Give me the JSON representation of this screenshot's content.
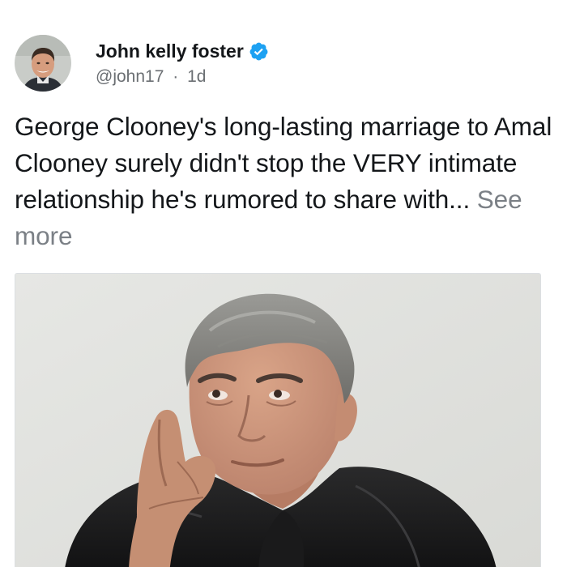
{
  "author": {
    "display_name": "John kelly foster",
    "handle": "@john17",
    "separator": "·",
    "time_ago": "1d",
    "verified": true
  },
  "tweet": {
    "text": "George Clooney's long-lasting marriage to Amal Clooney surely didn't stop the VERY intimate relationship he's rumored to share with... ",
    "see_more_label": "See more"
  },
  "colors": {
    "verified_badge": "#1da1f2",
    "text_primary": "#14171a",
    "text_secondary": "#6b6f73",
    "see_more": "#7b8086"
  },
  "icons": {
    "verified": "verified-badge-icon"
  }
}
